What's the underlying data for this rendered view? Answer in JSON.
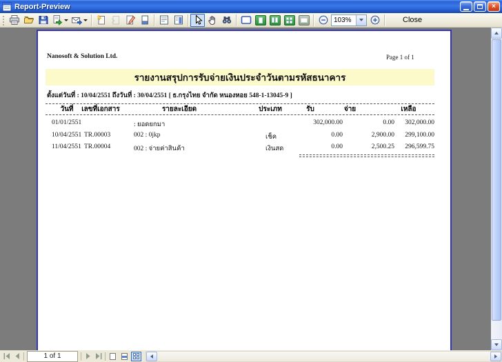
{
  "window": {
    "title": "Report-Preview"
  },
  "toolbar": {
    "zoom_level": "103%",
    "close_button": "Close",
    "icon_names": [
      "print-icon",
      "open-folder-icon",
      "save-icon",
      "export-icon",
      "send-mail-icon",
      "add-page-icon",
      "delete-page-icon",
      "edit-page-icon",
      "copy-page-icon",
      "report-style-icon",
      "report-columns-icon",
      "select-cursor-icon",
      "hand-tool-icon",
      "find-icon",
      "fit-window-icon",
      "whole-page-icon",
      "two-pages-icon",
      "multiple-pages-icon",
      "page-width-icon",
      "zoom-out-icon",
      "zoom-in-icon"
    ]
  },
  "report": {
    "company": "Nanosoft & Solution Ltd.",
    "page_label": "Page 1 of 1",
    "title": "รายงานสรุปการรับจ่ายเงินประจำวันตามรหัสธนาคาร",
    "date_range": "ตั้งแต่วันที่ : 10/04/2551 ถึงวันที่ : 30/04/2551 [ ธ.กรุงไทย จำกัด หนองหอย 548-1-13045-9 ]",
    "table": {
      "headers": [
        "วันที่",
        "เลขที่เอกสาร",
        "รายละเอียด",
        "ประเภท",
        "รับ",
        "จ่าย",
        "เหลือ"
      ],
      "rows": [
        [
          "01/01/2551",
          "",
          ": ยอดยกมา",
          "",
          "302,000.00",
          "0.00",
          "302,000.00"
        ],
        [
          "10/04/2551",
          "TR.00003",
          "002 : 0jkp",
          "เช็ค",
          "0.00",
          "2,900.00",
          "299,100.00"
        ],
        [
          "11/04/2551",
          "TR.00004",
          "002 : จ่ายค่าสินค้า",
          "เงินสด",
          "0.00",
          "2,500.25",
          "296,599.75"
        ]
      ]
    }
  },
  "statusbar": {
    "page_indicator": "1 of 1"
  },
  "colors": {
    "titlebar_blue": "#2a63d6",
    "toolbar_bg": "#ece9d8",
    "preview_bg": "#7c7c7c",
    "page_border": "#3434b8",
    "title_band_yellow": "#fcfacb",
    "pressed_accent": "#316ac5"
  }
}
